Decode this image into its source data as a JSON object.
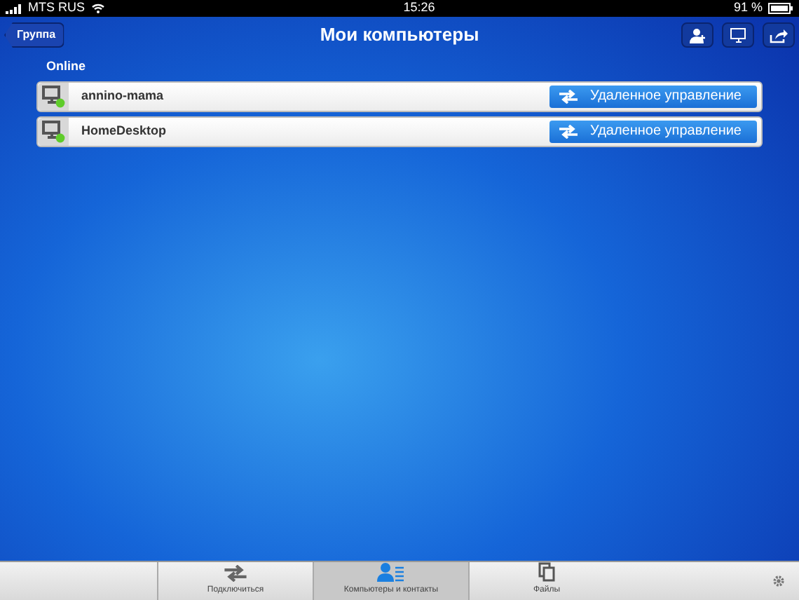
{
  "status_bar": {
    "carrier": "MTS RUS",
    "time": "15:26",
    "battery": "91 %"
  },
  "nav_bar": {
    "back_button": "Группа",
    "title": "Мои компьютеры"
  },
  "section": {
    "title": "Online"
  },
  "computers": [
    {
      "name": "annino-mama",
      "online": true,
      "action": "Удаленное управление"
    },
    {
      "name": "HomeDesktop",
      "online": true,
      "action": "Удаленное управление"
    }
  ],
  "tabs": [
    {
      "label": "Подключиться",
      "kind": "connect",
      "selected": false
    },
    {
      "label": "Компьютеры и контакты",
      "kind": "contacts",
      "selected": true
    },
    {
      "label": "Файлы",
      "kind": "files",
      "selected": false
    }
  ]
}
